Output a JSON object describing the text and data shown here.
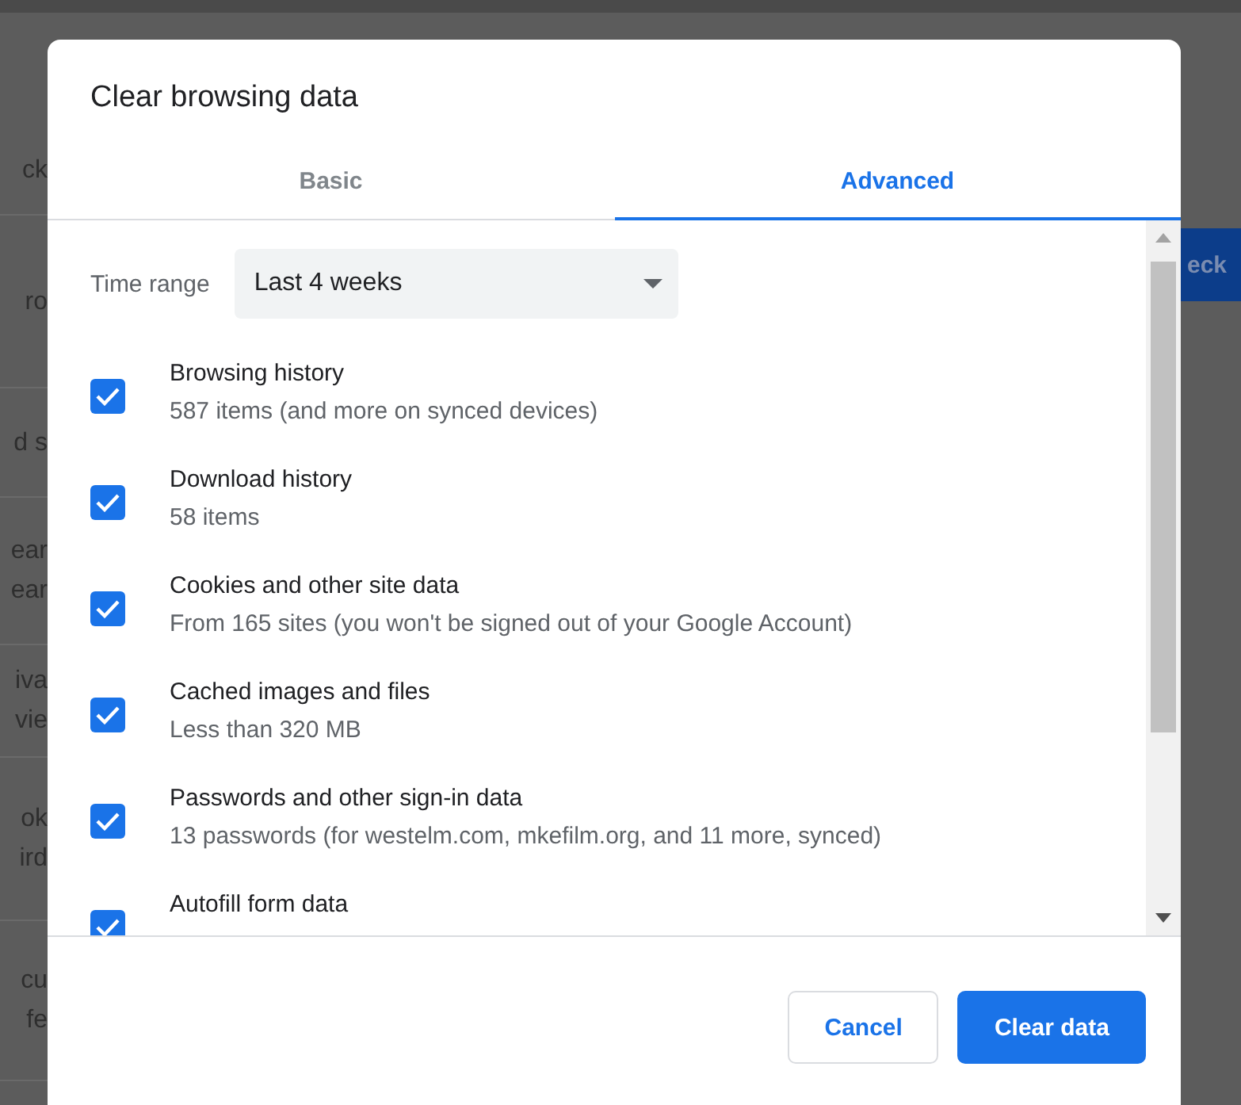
{
  "background": {
    "left_fragments": [
      {
        "lines": [
          "ck"
        ]
      },
      {
        "lines": [
          "ro"
        ]
      },
      {
        "lines": [
          "d s"
        ]
      },
      {
        "lines": [
          "ear",
          "ear"
        ]
      },
      {
        "lines": [
          "iva",
          "vie"
        ]
      },
      {
        "lines": [
          "ok",
          "ird"
        ]
      },
      {
        "lines": [
          "cu",
          "fe"
        ]
      }
    ],
    "right_button": "eck"
  },
  "dialog": {
    "title": "Clear browsing data",
    "tabs": [
      {
        "label": "Basic",
        "selected": false
      },
      {
        "label": "Advanced",
        "selected": true
      }
    ],
    "time_range": {
      "label": "Time range",
      "value": "Last 4 weeks"
    },
    "items": [
      {
        "title": "Browsing history",
        "detail": "587 items (and more on synced devices)",
        "checked": true
      },
      {
        "title": "Download history",
        "detail": "58 items",
        "checked": true
      },
      {
        "title": "Cookies and other site data",
        "detail": "From 165 sites (you won't be signed out of your Google Account)",
        "checked": true
      },
      {
        "title": "Cached images and files",
        "detail": "Less than 320 MB",
        "checked": true
      },
      {
        "title": "Passwords and other sign-in data",
        "detail": "13 passwords (for westelm.com, mkefilm.org, and 11 more, synced)",
        "checked": true
      },
      {
        "title": "Autofill form data",
        "checked": true
      }
    ],
    "buttons": [
      {
        "label": "Cancel",
        "kind": "secondary"
      },
      {
        "label": "Clear data",
        "kind": "primary"
      }
    ]
  }
}
